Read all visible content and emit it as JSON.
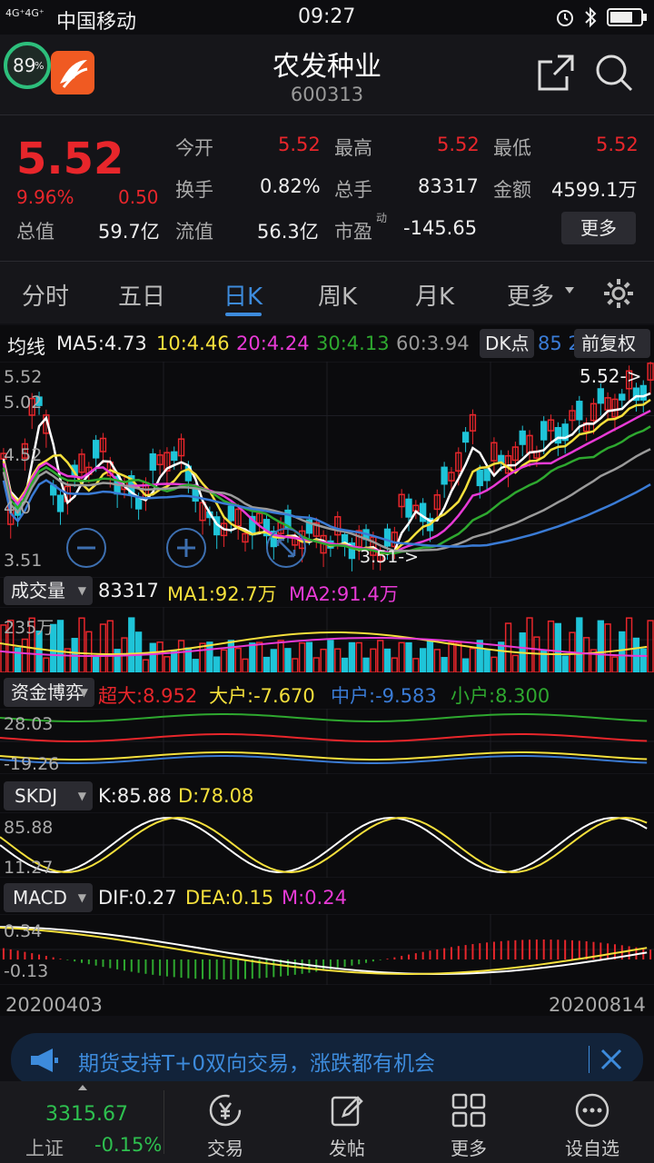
{
  "status_bar": {
    "signal": "4G⁺4G⁺",
    "carrier": "中国移动",
    "time": "09:27"
  },
  "header": {
    "badge_percent": "89",
    "badge_unit": "%",
    "stock_name": "农发种业",
    "stock_code": "600313"
  },
  "quote": {
    "price": "5.52",
    "change_pct": "9.96%",
    "change_amt": "0.50",
    "total_value_label": "总值",
    "total_value": "59.7亿",
    "open_label": "今开",
    "open": "5.52",
    "high_label": "最高",
    "high": "5.52",
    "low_label": "最低",
    "low": "5.52",
    "turnover_label": "换手",
    "turnover": "0.82%",
    "volume_label": "总手",
    "volume": "83317",
    "amount_label": "金额",
    "amount": "4599.1万",
    "float_label": "流值",
    "float_value": "56.3亿",
    "pe_label": "市盈",
    "pe_sup": "动",
    "pe": "-145.65",
    "more_button": "更多"
  },
  "tabs": [
    {
      "label": "分时"
    },
    {
      "label": "五日"
    },
    {
      "label": "日K"
    },
    {
      "label": "周K"
    },
    {
      "label": "月K"
    },
    {
      "label": "更多"
    }
  ],
  "ma_bar": {
    "title": "均线",
    "ma5": "MA5:4.73",
    "ma10": "10:4.46",
    "ma20": "20:4.24",
    "ma30": "30:4.13",
    "ma60": "60:3.94",
    "dk_button": "DK点",
    "cut_text": "85 2",
    "adjust_button": "前复权"
  },
  "kline": {
    "y_labels": [
      "5.52",
      "5.02",
      "4.52",
      "4.0",
      "3.51"
    ],
    "last_price_marker": "5.52->",
    "low_marker": "3.51->"
  },
  "volume_panel": {
    "select": "成交量",
    "value": "83317",
    "ma1": "MA1:92.7万",
    "ma2": "MA2:91.4万",
    "y_label": "235万"
  },
  "fund_panel": {
    "select": "资金博弈",
    "super": "超大:8.952",
    "big": "大户:-7.670",
    "mid": "中户:-9.583",
    "small": "小户:8.300",
    "y_top": "28.03",
    "y_bottom": "-19.26"
  },
  "skdj_panel": {
    "select": "SKDJ",
    "k": "K:85.88",
    "d": "D:78.08",
    "y_top": "85.88",
    "y_bottom": "11.27"
  },
  "macd_panel": {
    "select": "MACD",
    "dif": "DIF:0.27",
    "dea": "DEA:0.15",
    "m": "M:0.24",
    "y_top": "0.34",
    "y_bottom": "-0.13"
  },
  "dates": {
    "start": "20200403",
    "end": "20200814"
  },
  "banner": {
    "text": "期货支持T+0双向交易，涨跌都有机会"
  },
  "bottom_nav": {
    "index_value": "3315.67",
    "index_name": "上证",
    "index_change": "-0.15%",
    "items": [
      {
        "label": "交易"
      },
      {
        "label": "发帖"
      },
      {
        "label": "更多"
      },
      {
        "label": "设自选"
      }
    ]
  },
  "colors": {
    "up": "#e8262b",
    "down": "#1fc4d8",
    "ma5": "#ffffff",
    "ma10": "#f5e03c",
    "ma20": "#e83ad6",
    "ma30": "#2ea82f",
    "ma60": "#9a9a9a",
    "ma_blue": "#3a7bd5",
    "accent": "#3d8bdc"
  }
}
